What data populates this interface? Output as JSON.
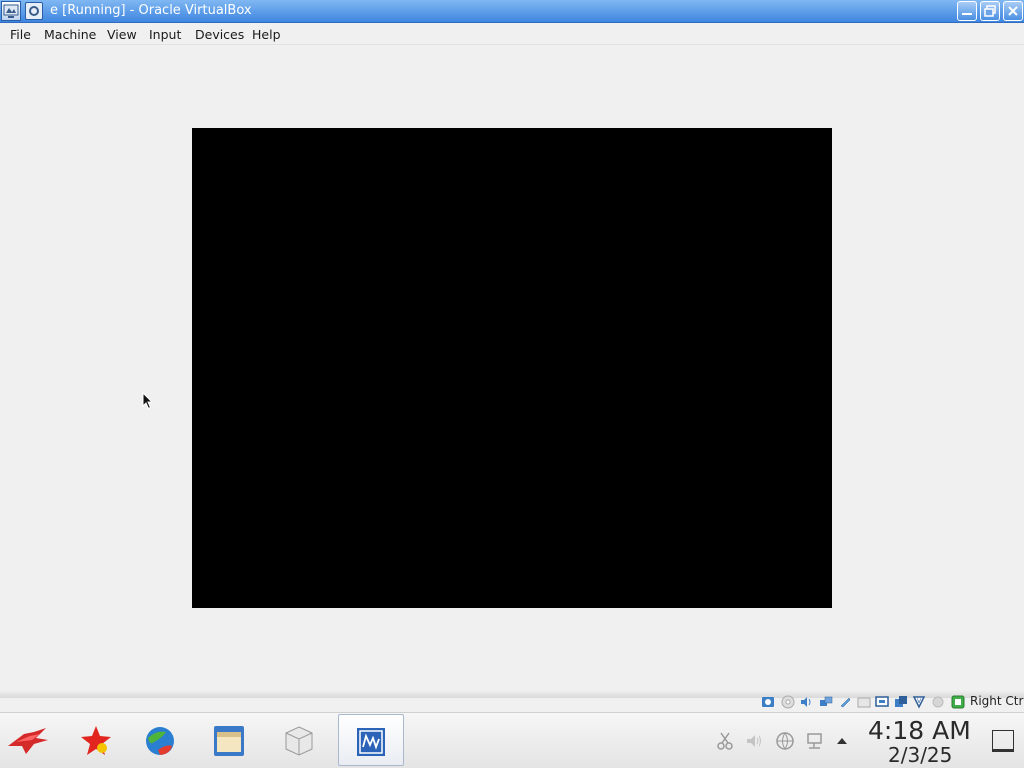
{
  "window": {
    "title": "e [Running] - Oracle VirtualBox",
    "app_icon": "virtualbox-icon",
    "controls": [
      "minimize-icon",
      "restore-icon",
      "close-icon"
    ]
  },
  "menubar": {
    "items": [
      "File",
      "Machine",
      "View",
      "Input",
      "Devices",
      "Help"
    ]
  },
  "vm_display": {
    "state": "black-screen"
  },
  "statusbar": {
    "indicators": [
      "hard-disk-icon",
      "optical-drive-icon",
      "audio-icon",
      "network-icon",
      "usb-icon",
      "shared-folders-icon",
      "display-icon",
      "video-capture-icon",
      "recording-icon",
      "mouse-integration-icon",
      "cpu-icon",
      "keyboard-icon"
    ],
    "host_key": "Right Ctrl"
  },
  "taskbar": {
    "apps": [
      {
        "name": "start-menu-icon",
        "active": false
      },
      {
        "name": "app-star-icon",
        "active": false
      },
      {
        "name": "browser-globe-icon",
        "active": false
      },
      {
        "name": "file-manager-icon",
        "active": false
      },
      {
        "name": "package-box-icon",
        "active": false
      },
      {
        "name": "virtualbox-task-icon",
        "active": true
      }
    ],
    "tray": [
      "clipboard-icon",
      "volume-icon",
      "network-globe-icon",
      "computer-network-icon",
      "tray-expand-icon"
    ],
    "clock": {
      "time": "4:18 AM",
      "date": "2/3/25"
    },
    "show_desktop": "show-desktop-icon"
  },
  "colors": {
    "titlebar": "#3f86e0",
    "background": "#f0f0f0",
    "vm_screen": "#000000"
  }
}
